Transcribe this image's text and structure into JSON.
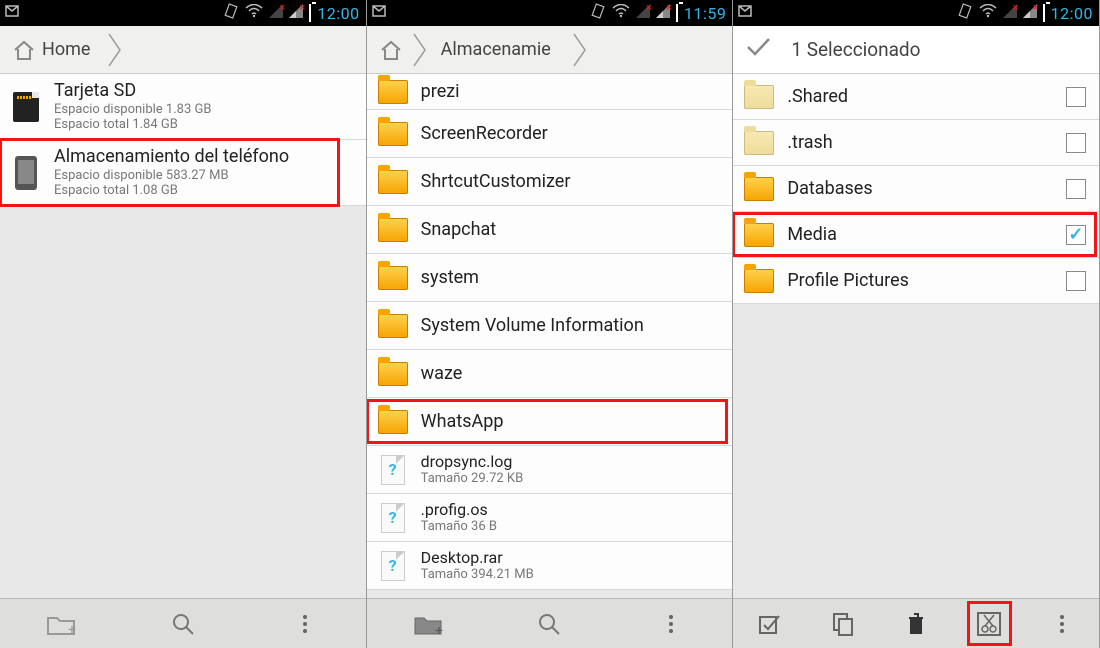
{
  "panel1": {
    "status_time": "12:00",
    "crumb": "Home",
    "storage": [
      {
        "title": "Tarjeta SD",
        "avail_label": "Espacio disponible 1.83 GB",
        "total_label": "Espacio total 1.84 GB"
      },
      {
        "title": "Almacenamiento del teléfono",
        "avail_label": "Espacio disponible 583.27 MB",
        "total_label": "Espacio total 1.08 GB"
      }
    ]
  },
  "panel2": {
    "status_time": "11:59",
    "crumb": "Almacenamie",
    "folders": [
      "prezi",
      "ScreenRecorder",
      "ShrtcutCustomizer",
      "Snapchat",
      "system",
      "System Volume Information",
      "waze",
      "WhatsApp"
    ],
    "files": [
      {
        "name": "dropsync.log",
        "size_label": "Tamaño 29.72 KB"
      },
      {
        "name": ".profig.os",
        "size_label": "Tamaño 36 B"
      },
      {
        "name": "Desktop.rar",
        "size_label": "Tamaño 394.21 MB"
      }
    ]
  },
  "panel3": {
    "status_time": "12:00",
    "selection_label": "1 Seleccionado",
    "items": [
      {
        "name": ".Shared",
        "pale": true,
        "checked": false
      },
      {
        "name": ".trash",
        "pale": true,
        "checked": false
      },
      {
        "name": "Databases",
        "pale": false,
        "checked": false
      },
      {
        "name": "Media",
        "pale": false,
        "checked": true
      },
      {
        "name": "Profile Pictures",
        "pale": false,
        "checked": false
      }
    ]
  }
}
